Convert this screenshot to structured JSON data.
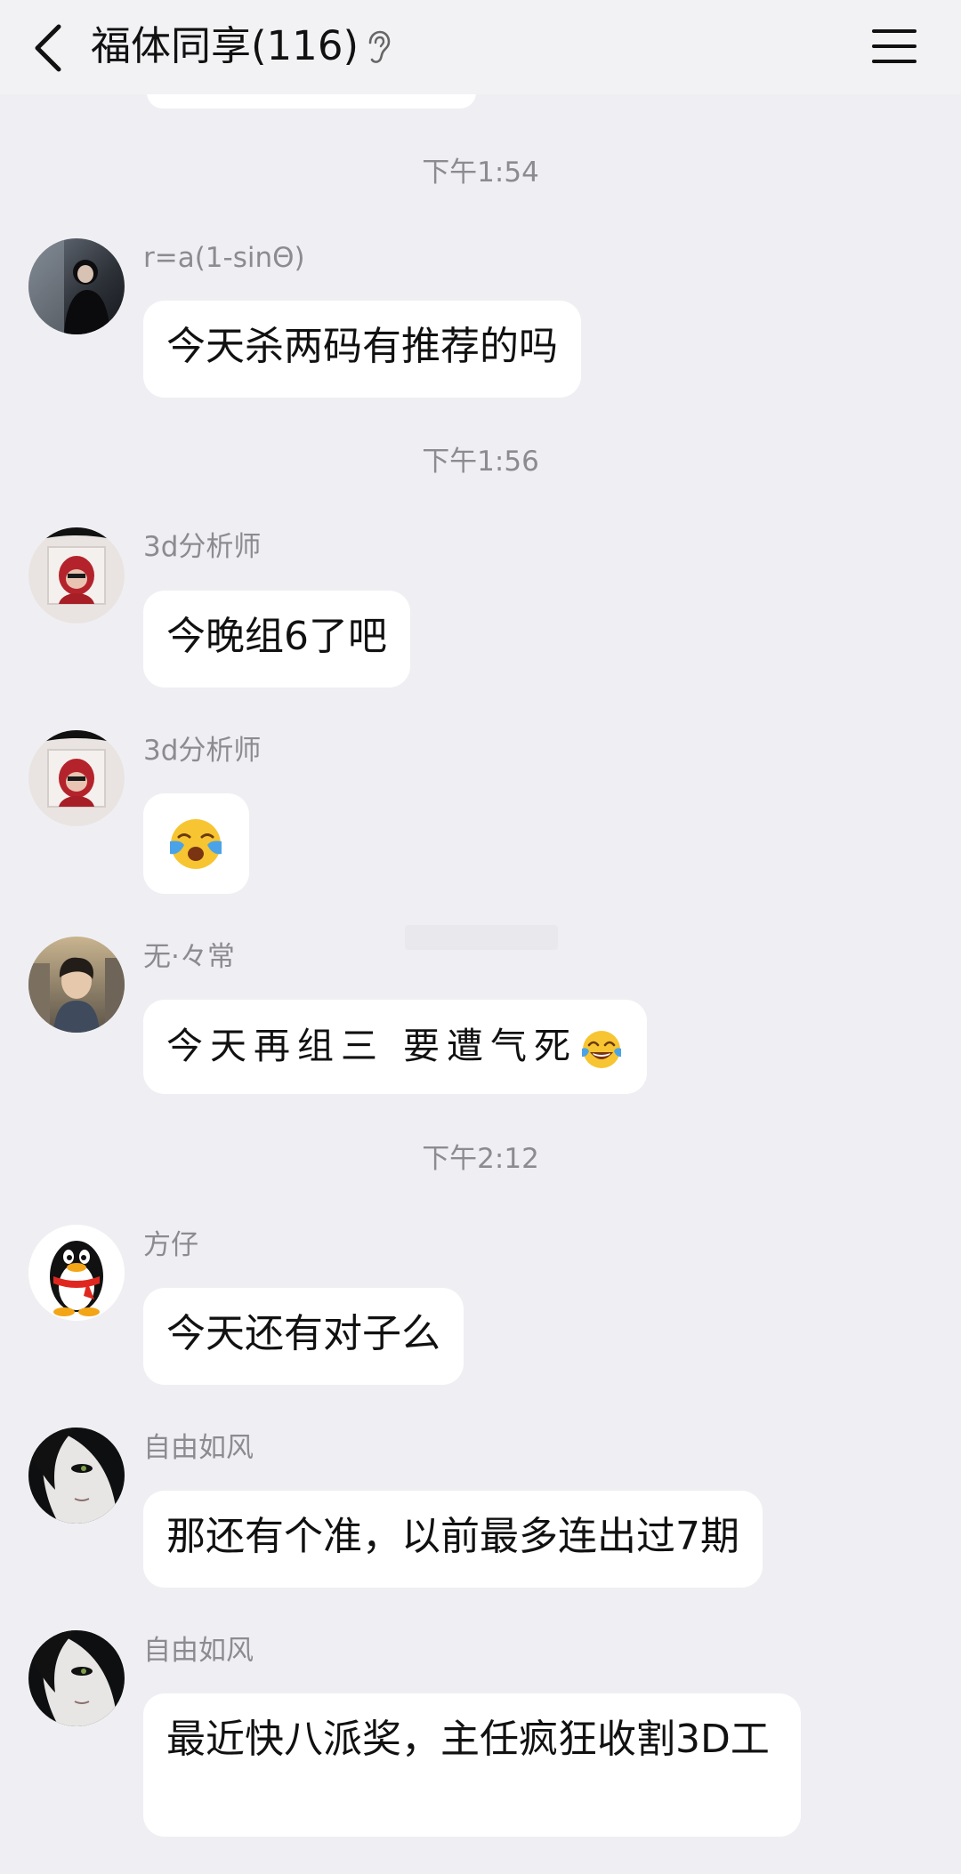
{
  "header": {
    "title": "福体同享(116)",
    "back_icon": "chevron-left-icon",
    "ear_icon": "ear-icon",
    "menu_icon": "hamburger-menu-icon"
  },
  "timestamps": [
    "下午1:54",
    "下午1:56",
    "下午2:12"
  ],
  "messages": [
    {
      "sender": "r=a(1-sinΘ)",
      "text": "今天杀两码有推荐的吗",
      "avatar": "woman-photo-avatar"
    },
    {
      "sender": "3d分析师",
      "text": "今晚组6了吧",
      "avatar": "red-hood-girl-avatar"
    },
    {
      "sender": "3d分析师",
      "emoji": "loudly-crying-face-icon",
      "avatar": "red-hood-girl-avatar"
    },
    {
      "sender": "无·々常",
      "text": "今天再组三 要遭气死",
      "emoji": "tears-of-joy-icon",
      "avatar": "anime-boy-avatar"
    },
    {
      "sender": "方仔",
      "text": "今天还有对子么",
      "avatar": "qq-penguin-avatar"
    },
    {
      "sender": "自由如风",
      "text": "那还有个准，以前最多连出过7期",
      "avatar": "dark-face-avatar"
    },
    {
      "sender": "自由如风",
      "text": "最近快八派奖，主任疯狂收割3D工",
      "avatar": "dark-face-avatar"
    }
  ]
}
